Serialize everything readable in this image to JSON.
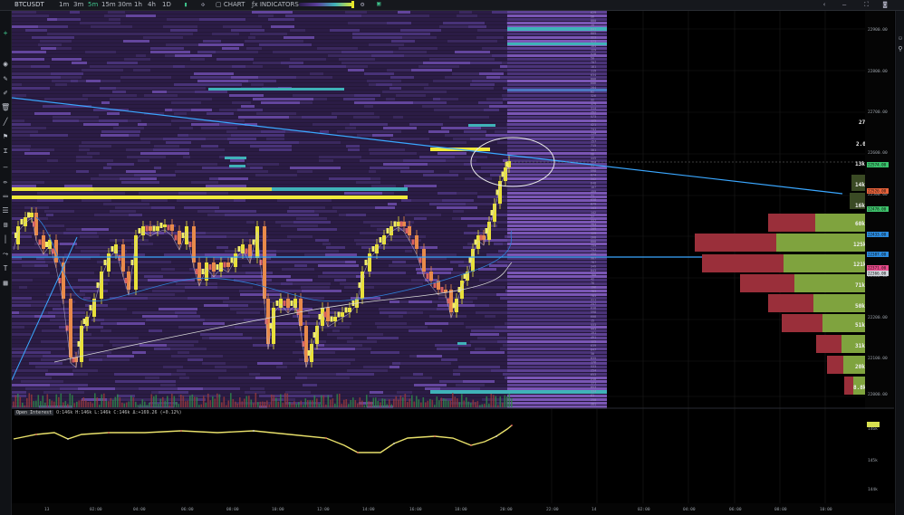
{
  "toolbar": {
    "symbol": "BTCUSDT",
    "timeframes": [
      "1m",
      "3m",
      "5m",
      "15m",
      "30m",
      "1h",
      "4h",
      "1D"
    ],
    "active_timeframe": "5m",
    "chart_label": "CHART",
    "indicators_label": "INDICATORS"
  },
  "price_axis": {
    "labels": [
      "22900.00",
      "22800.00",
      "22700.00",
      "22600.00",
      "22500.00",
      "22400.00",
      "22300.00",
      "22200.00",
      "22100.00",
      "22000.00"
    ]
  },
  "price_tags": [
    {
      "text": "22574.00",
      "color": "#39c46c"
    },
    {
      "text": "22526.00",
      "color": "#e8623a"
    },
    {
      "text": "22478.00",
      "color": "#3ec46c"
    },
    {
      "text": "22433.00",
      "color": "#2a8be0"
    },
    {
      "text": "22387.00",
      "color": "#2a8be0"
    },
    {
      "text": "22371.00",
      "color": "#e84a8a"
    },
    {
      "text": "22366.00",
      "color": "#cfd3da"
    }
  ],
  "time_axis": {
    "labels": [
      "13",
      "02:00",
      "04:00",
      "06:00",
      "08:00",
      "10:00",
      "12:00",
      "14:00",
      "16:00",
      "18:00",
      "20:00",
      "22:00",
      "14",
      "02:00",
      "04:00",
      "06:00",
      "08:00",
      "10:00"
    ]
  },
  "volume_profile_labels": [
    "273",
    "2.0k",
    "13k",
    "14k",
    "16k",
    "60k",
    "125k",
    "121k",
    "71k",
    "50k",
    "51k",
    "31k",
    "20k",
    "8.8k"
  ],
  "open_interest": {
    "title": "Open Interest",
    "values": "O:146k H:146k L:146k C:146k Δ:+169.26 (+0.12%)",
    "axis_labels": [
      "146k",
      "145k",
      "144k"
    ]
  },
  "colors": {
    "background": "#000000",
    "heatmap_purple": "#3d2a63",
    "heatmap_bright": "#7a56b5",
    "trendline": "#3aa7ff",
    "bid_green": "#7fa33e",
    "ask_red": "#9a2f3a"
  },
  "icons": [
    "crosshair-icon",
    "eye-icon",
    "pencil-icon",
    "trash-icon",
    "trendline-icon",
    "flag-icon",
    "ruler-icon",
    "brush-icon",
    "rectangle-icon",
    "fib-icon",
    "text-icon",
    "camera-icon",
    "settings-icon"
  ]
}
